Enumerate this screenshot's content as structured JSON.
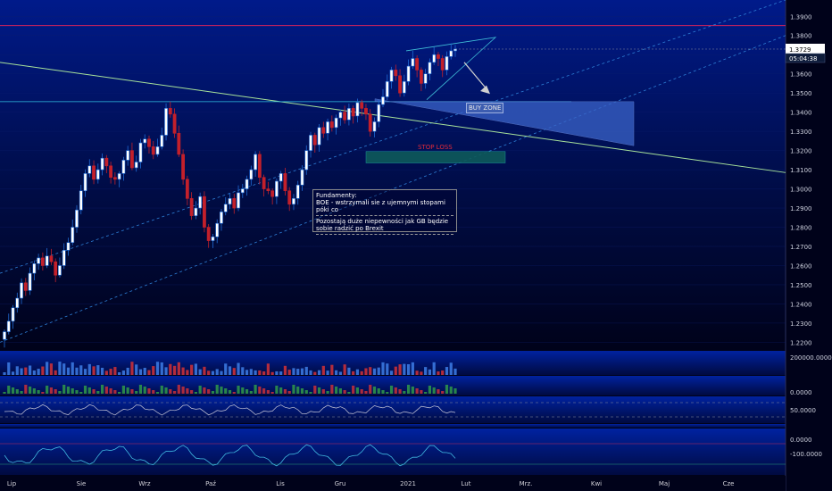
{
  "chart_data": {
    "type": "candlestick",
    "price_axis": {
      "ticks": [
        "1.3900",
        "1.3800",
        "1.3700",
        "1.3600",
        "1.3500",
        "1.3400",
        "1.3300",
        "1.3200",
        "1.3100",
        "1.3000",
        "1.2900",
        "1.2800",
        "1.2700",
        "1.2600",
        "1.2500",
        "1.2400",
        "1.2300",
        "1.2200"
      ],
      "range": [
        1.216,
        1.3985
      ]
    },
    "time_axis": {
      "labels": [
        "Lip",
        "Sie",
        "Wrz",
        "Paź",
        "Lis",
        "Gru",
        "2021",
        "Lut",
        "Mrz.",
        "Kwi",
        "Maj",
        "Cze"
      ]
    },
    "last_price": "1.3729",
    "countdown": "05:04:38",
    "levels": {
      "resistance": 1.3852,
      "support_line": 1.3455,
      "stop_level": 1.3173
    },
    "zones": {
      "buy_zone_label": "BUY ZONE",
      "stop_label": "STOP LOSS"
    },
    "closes": [
      1.2255,
      1.231,
      1.238,
      1.243,
      1.251,
      1.247,
      1.256,
      1.261,
      1.264,
      1.26,
      1.265,
      1.262,
      1.255,
      1.26,
      1.268,
      1.272,
      1.28,
      1.289,
      1.299,
      1.308,
      1.312,
      1.305,
      1.31,
      1.316,
      1.312,
      1.306,
      1.305,
      1.308,
      1.315,
      1.32,
      1.311,
      1.314,
      1.324,
      1.326,
      1.322,
      1.318,
      1.322,
      1.328,
      1.342,
      1.339,
      1.329,
      1.318,
      1.305,
      1.295,
      1.286,
      1.29,
      1.296,
      1.28,
      1.273,
      1.275,
      1.282,
      1.288,
      1.292,
      1.295,
      1.29,
      1.298,
      1.3,
      1.305,
      1.31,
      1.318,
      1.306,
      1.3,
      1.299,
      1.296,
      1.304,
      1.308,
      1.299,
      1.292,
      1.295,
      1.302,
      1.31,
      1.32,
      1.328,
      1.323,
      1.332,
      1.329,
      1.335,
      1.332,
      1.337,
      1.34,
      1.336,
      1.342,
      1.338,
      1.345,
      1.342,
      1.339,
      1.33,
      1.335,
      1.344,
      1.348,
      1.356,
      1.362,
      1.359,
      1.35,
      1.356,
      1.364,
      1.368,
      1.362,
      1.355,
      1.36,
      1.366,
      1.37,
      1.368,
      1.362,
      1.369,
      1.372,
      1.3729
    ],
    "indicators": {
      "volume_label": "200000.0000",
      "macd_label": "0.0000",
      "rsi_label": "50.0000",
      "osc_zero_label": "0.0000",
      "osc_low_label": "-100.0000"
    },
    "annotation": {
      "title": "Fundamenty:",
      "line1": "BOE - wstrzymali sie z ujemnymi stopami póki co",
      "line2": "Pozostają duże niepewności jak GB będzie",
      "line3": "sobie radzić po Brexit"
    }
  },
  "colors": {
    "up": "#1f6bd6",
    "down": "#c3202b",
    "bull_body": "#ffffff",
    "trend_green": "#a8e39a",
    "resistance": "#d4225c",
    "grid": "#1a2255",
    "axis_text": "#c8c8c8",
    "price_tag_bg": "#ffffff"
  }
}
